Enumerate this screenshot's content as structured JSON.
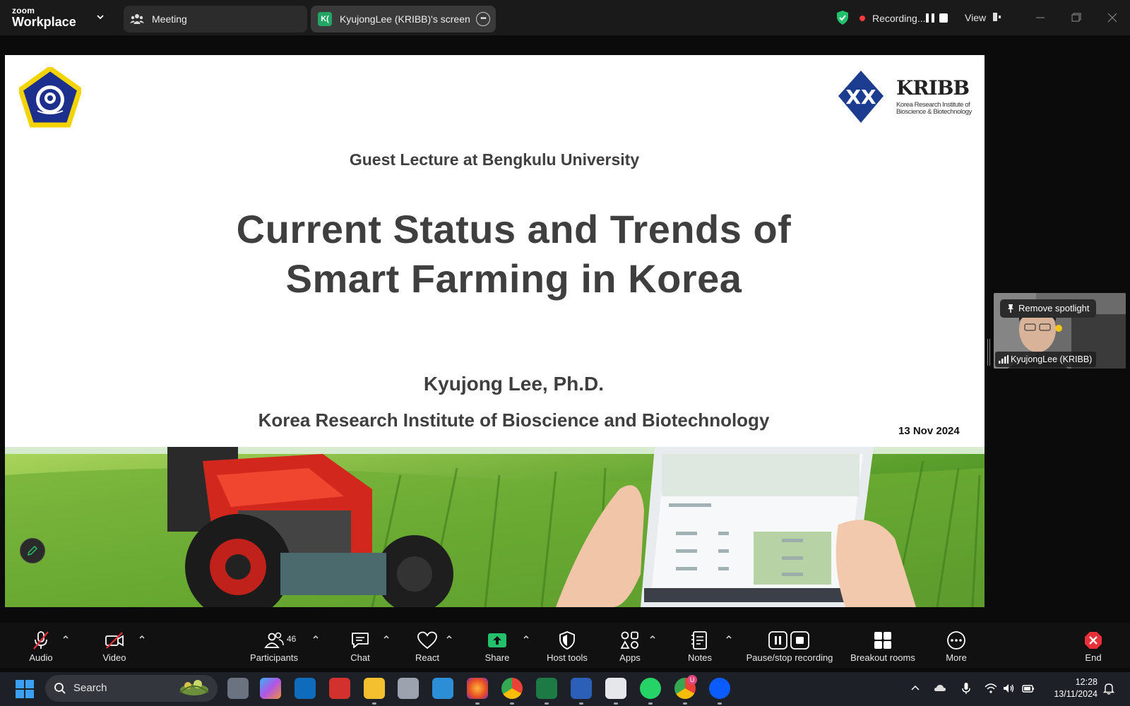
{
  "app": {
    "brand_small": "zoom",
    "brand_large": "Workplace",
    "tabs": [
      {
        "label": "Meeting"
      },
      {
        "label": "KyujongLee (KRIBB)'s screen",
        "avatar": "K("
      }
    ],
    "recording_label": "Recording...",
    "view_label": "View"
  },
  "slide": {
    "kribb_word": "KRIBB",
    "kribb_sub": "Korea Research Institute of Bioscience & Biotechnology",
    "guest": "Guest Lecture at Bengkulu University",
    "title_line1": "Current Status and Trends of",
    "title_line2": "Smart Farming in Korea",
    "author": "Kyujong Lee, Ph.D.",
    "institute": "Korea Research Institute of Bioscience and Biotechnology",
    "date": "13 Nov 2024"
  },
  "video": {
    "spotlight_label": "Remove spotlight",
    "participant_name": "KyujongLee (KRIBB)"
  },
  "toolbar": {
    "audio": "Audio",
    "video": "Video",
    "participants": "Participants",
    "participants_count": "46",
    "chat": "Chat",
    "react": "React",
    "share": "Share",
    "host_tools": "Host tools",
    "apps": "Apps",
    "notes": "Notes",
    "pause_stop": "Pause/stop recording",
    "breakout": "Breakout rooms",
    "more": "More",
    "end": "End"
  },
  "taskbar": {
    "search_label": "Search",
    "time": "12:28",
    "date": "13/11/2024",
    "badge": "U"
  },
  "colors": {
    "accent_green": "#23c16b",
    "record_red": "#ff3b3b",
    "end_red": "#e8303a",
    "slide_text": "#3f3f3f"
  }
}
